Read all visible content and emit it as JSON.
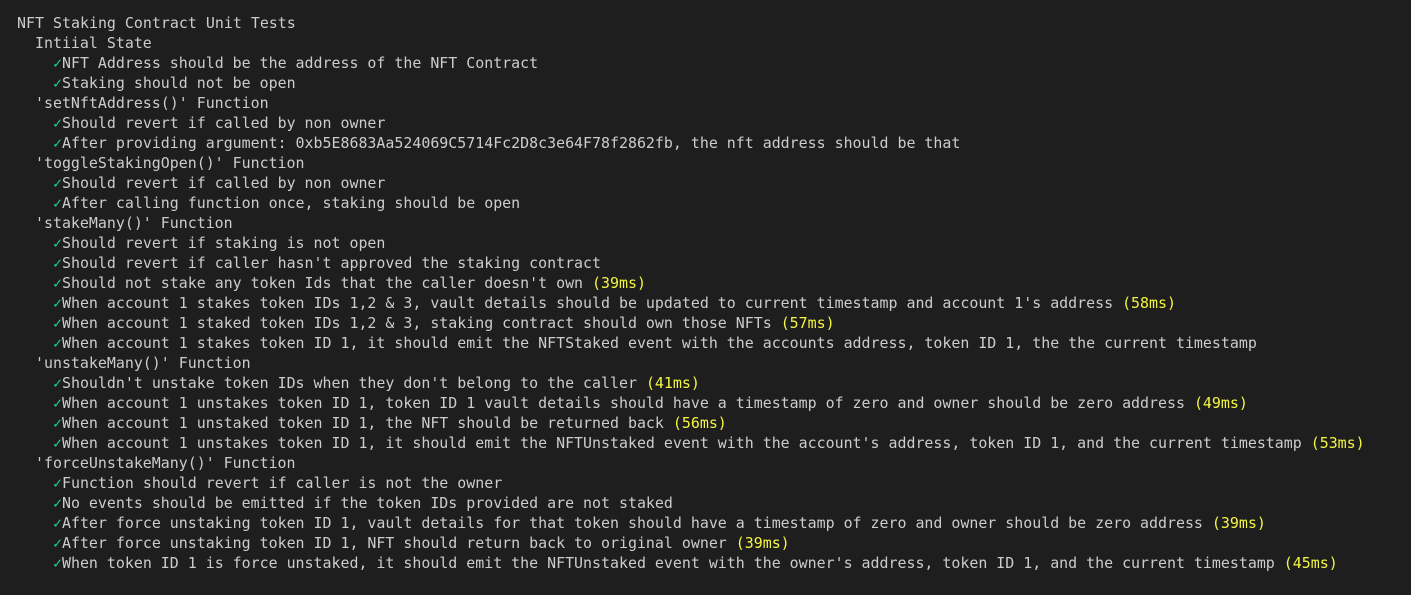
{
  "colors": {
    "background": "#1e1e1e",
    "text": "#cccccc",
    "pass_check": "#23d18b",
    "duration": "#f5f543"
  },
  "icons": {
    "pass": "check-icon"
  },
  "check_glyph": "✓",
  "suite": {
    "title": "NFT Staking Contract Unit Tests",
    "groups": [
      {
        "title": "Intiial State",
        "tests": [
          {
            "text": "NFT Address should be the address of the NFT Contract",
            "duration": ""
          },
          {
            "text": "Staking should not be open",
            "duration": ""
          }
        ]
      },
      {
        "title": "'setNftAddress()' Function",
        "tests": [
          {
            "text": "Should revert if called by non owner",
            "duration": ""
          },
          {
            "text": "After providing argument: 0xb5E8683Aa524069C5714Fc2D8c3e64F78f2862fb, the nft address should be that",
            "duration": ""
          }
        ]
      },
      {
        "title": "'toggleStakingOpen()' Function",
        "tests": [
          {
            "text": "Should revert if called by non owner",
            "duration": ""
          },
          {
            "text": "After calling function once, staking should be open",
            "duration": ""
          }
        ]
      },
      {
        "title": "'stakeMany()' Function",
        "tests": [
          {
            "text": "Should revert if staking is not open",
            "duration": ""
          },
          {
            "text": "Should revert if caller hasn't approved the staking contract",
            "duration": ""
          },
          {
            "text": "Should not stake any token Ids that the caller doesn't own",
            "duration": "(39ms)"
          },
          {
            "text": "When account 1 stakes token IDs 1,2 & 3, vault details should be updated to current timestamp and account 1's address",
            "duration": "(58ms)"
          },
          {
            "text": "When account 1 staked token IDs 1,2 & 3, staking contract should own those NFTs",
            "duration": "(57ms)"
          },
          {
            "text": "When account 1 stakes token ID 1, it should emit the NFTStaked event with the accounts address, token ID 1, the the current timestamp",
            "duration": ""
          }
        ]
      },
      {
        "title": "'unstakeMany()' Function",
        "tests": [
          {
            "text": "Shouldn't unstake token IDs when they don't belong to the caller",
            "duration": "(41ms)"
          },
          {
            "text": "When account 1 unstakes token ID 1, token ID 1 vault details should have a timestamp of zero and owner should be zero address",
            "duration": "(49ms)"
          },
          {
            "text": "When account 1 unstaked token ID 1, the NFT should be returned back",
            "duration": "(56ms)"
          },
          {
            "text": "When account 1 unstakes token ID 1, it should emit the NFTUnstaked event with the account's address, token ID 1, and the current timestamp",
            "duration": "(53ms)"
          }
        ]
      },
      {
        "title": "'forceUnstakeMany()' Function",
        "tests": [
          {
            "text": "Function should revert if caller is not the owner",
            "duration": ""
          },
          {
            "text": "No events should be emitted if the token IDs provided are not staked",
            "duration": ""
          },
          {
            "text": "After force unstaking token ID 1, vault details for that token should have a timestamp of zero and owner should be zero address",
            "duration": "(39ms)"
          },
          {
            "text": "After force unstaking token ID 1, NFT should return back to original owner",
            "duration": "(39ms)"
          },
          {
            "text": "When token ID 1 is force unstaked, it should emit the NFTUnstaked event with the owner's address, token ID 1, and the current timestamp",
            "duration": "(45ms)"
          }
        ]
      }
    ]
  }
}
